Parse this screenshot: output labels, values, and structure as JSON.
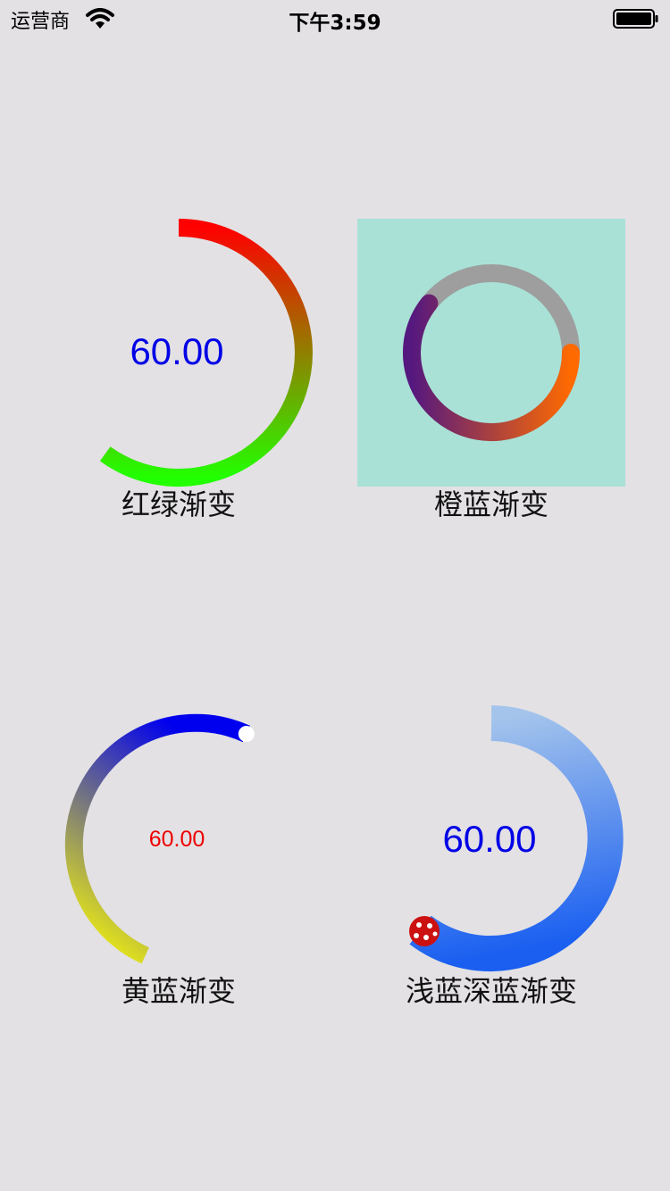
{
  "status_bar": {
    "carrier": "运营商",
    "time": "下午3:59"
  },
  "gauges": {
    "red_green": {
      "label": "红绿渐变",
      "value_text": "60.00",
      "colors": {
        "start": "#ff0000",
        "end": "#22ff00",
        "value_text": "#0000e6"
      }
    },
    "orange_blue": {
      "label": "橙蓝渐变",
      "colors": {
        "background": "#a9e1d7",
        "track": "#9e9e9e",
        "start": "#ff6a00",
        "end": "#55187f"
      }
    },
    "yellow_blue": {
      "label": "黄蓝渐变",
      "value_text": "60.00",
      "colors": {
        "start": "#ffff00",
        "end": "#0000ee",
        "value_text": "#ee0000",
        "knob": "#ffffff"
      }
    },
    "light_dark_blue": {
      "label": "浅蓝深蓝渐变",
      "value_text": "60.00",
      "colors": {
        "start": "#a4c4ec",
        "end": "#1a5ff0",
        "value_text": "#0000e6",
        "knob": "#cc1111"
      }
    }
  }
}
